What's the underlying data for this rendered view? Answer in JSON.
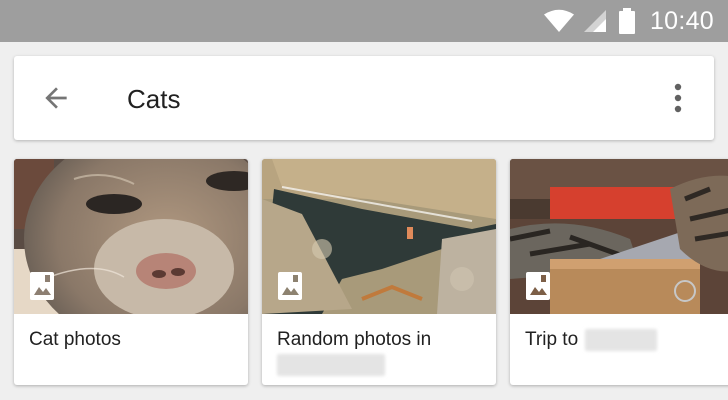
{
  "status_bar": {
    "time": "10:40"
  },
  "search_bar": {
    "title": "Cats"
  },
  "albums": [
    {
      "label": "Cat photos"
    },
    {
      "label": "Random photos in"
    },
    {
      "label": "Trip to"
    }
  ],
  "icons": {
    "status": [
      "wifi-icon",
      "signal-icon",
      "battery-icon"
    ],
    "search_bar": [
      "back-arrow-icon",
      "more-vert-icon"
    ],
    "album": "photo-album-icon"
  },
  "colors": {
    "status_bar": "#9e9e9e",
    "background": "#efefef",
    "card": "#ffffff",
    "text": "#212121"
  }
}
